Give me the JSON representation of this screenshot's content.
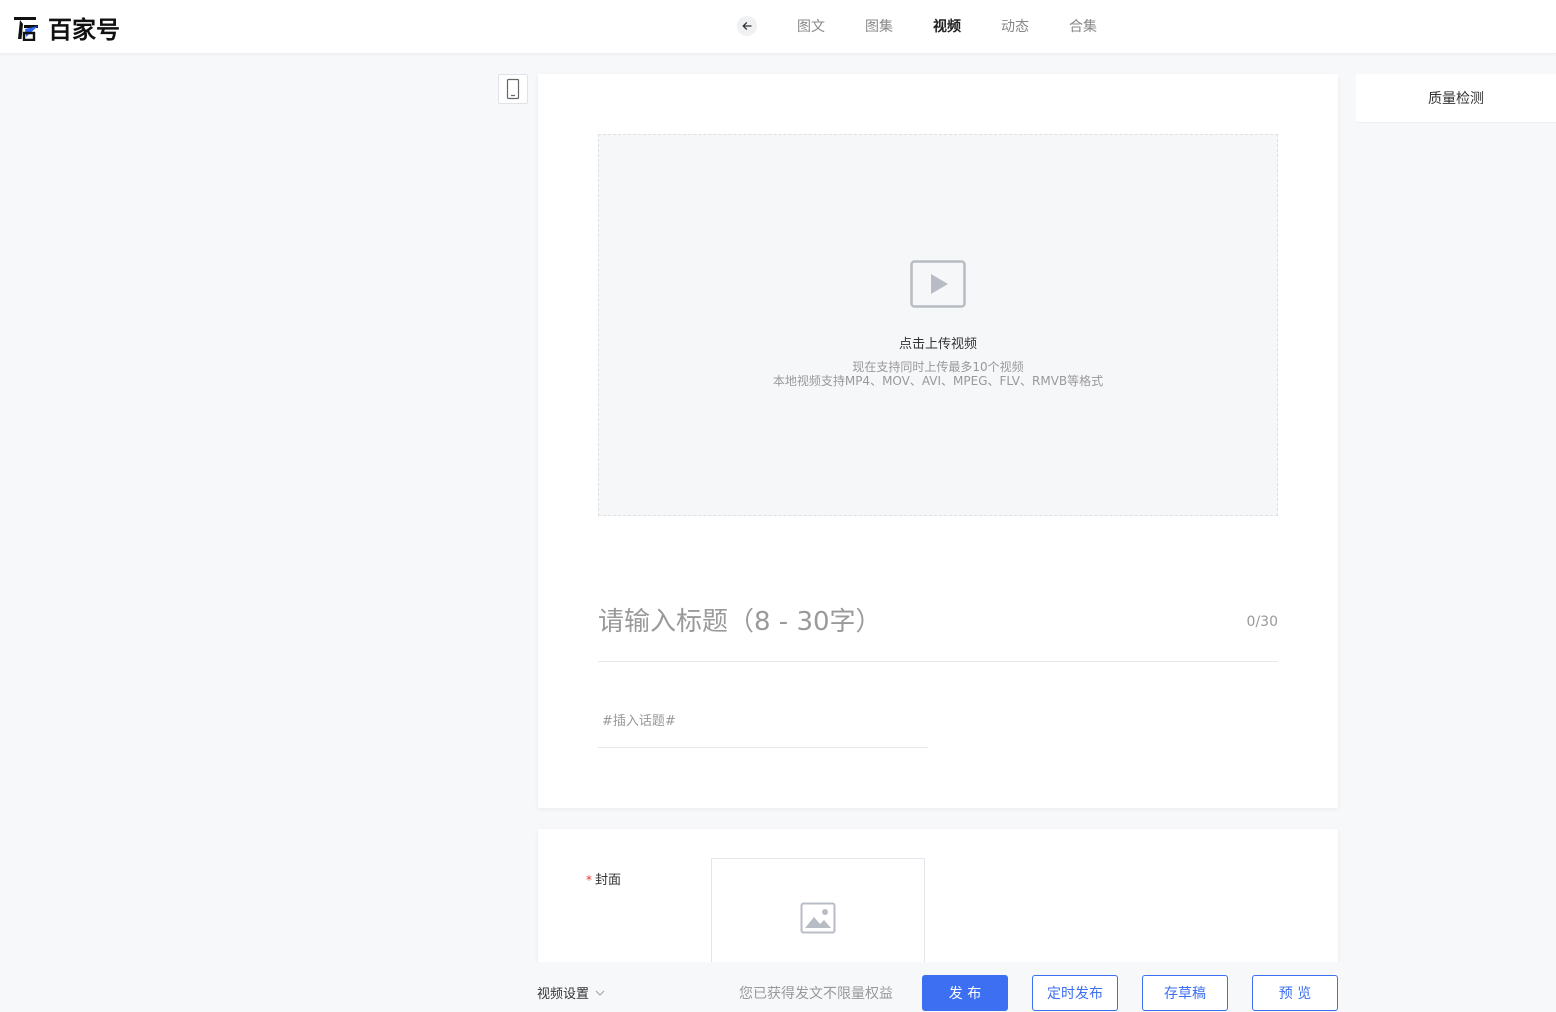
{
  "app": {
    "brand": "百家号",
    "accent_color": "#3d6ff2"
  },
  "nav": {
    "back_icon": "arrow-left-icon",
    "tabs": [
      {
        "label": "图文",
        "active": false
      },
      {
        "label": "图集",
        "active": false
      },
      {
        "label": "视频",
        "active": true
      },
      {
        "label": "动态",
        "active": false
      },
      {
        "label": "合集",
        "active": false
      }
    ]
  },
  "device_toggle": {
    "icon": "mobile-phone-icon"
  },
  "upload": {
    "icon": "video-play-icon",
    "title": "点击上传视频",
    "hint_line1": "现在支持同时上传最多10个视频",
    "hint_line2": "本地视频支持MP4、MOV、AVI、MPEG、FLV、RMVB等格式"
  },
  "title_field": {
    "placeholder": "请输入标题（8 - 30字）",
    "value": "",
    "counter": "0/30"
  },
  "topic_field": {
    "placeholder": "#插入话题#",
    "value": ""
  },
  "quality_check": {
    "label": "质量检测"
  },
  "cover": {
    "required_mark": "*",
    "label": "封面",
    "icon": "image-placeholder-icon"
  },
  "bottom_bar": {
    "video_settings_label": "视频设置",
    "rights_text": "您已获得发文不限量权益",
    "publish_label": "发 布",
    "schedule_label": "定时发布",
    "draft_label": "存草稿",
    "preview_label": "预 览"
  }
}
